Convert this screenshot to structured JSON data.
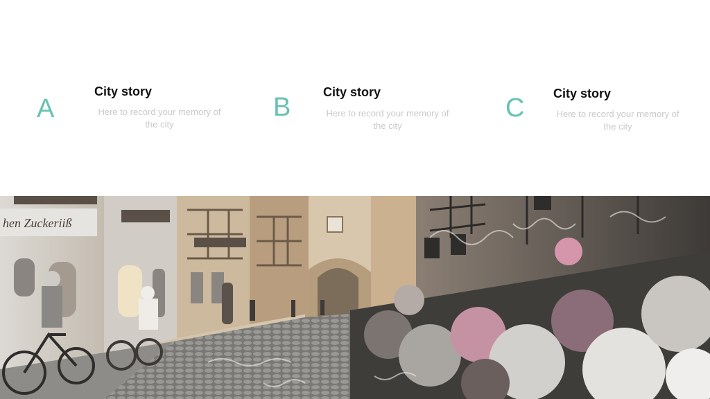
{
  "features": [
    {
      "letter": "A",
      "title": "City story",
      "description": "Here to record your memory of the city"
    },
    {
      "letter": "B",
      "title": "City story",
      "description": "Here to record your memory of the city"
    },
    {
      "letter": "C",
      "title": "City story",
      "description": "Here to record your memory of the city"
    }
  ],
  "photo": {
    "sign_text": "hen Zuckeriiß"
  },
  "colors": {
    "accent": "#66c2b2",
    "title": "#111111",
    "description": "#c9c9c9"
  }
}
